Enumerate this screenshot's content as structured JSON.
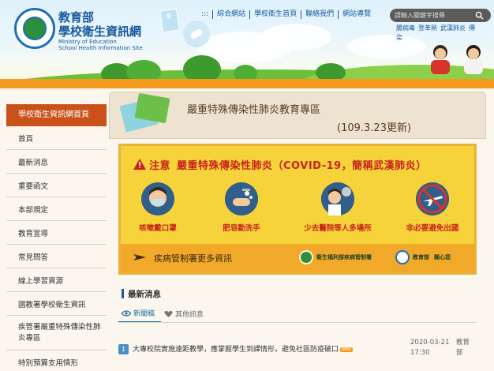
{
  "header": {
    "logo_ring_text": "MINISTRY OF EDUCATION",
    "title_line1": "教育部",
    "title_line2": "學校衛生資訊網",
    "title_en1": "Ministry of Education",
    "title_en2": "School Health Information Site",
    "deco_card_text": "E",
    "nav": [
      "綜合網站",
      "學校衛生首頁",
      "聯絡我們",
      "網站導覽"
    ],
    "nav_prefix": ":::",
    "search_placeholder": "請輸入關鍵字搜尋",
    "hot_keywords": [
      "腸病毒",
      "登革熱",
      "武漢肺炎",
      "傳染"
    ]
  },
  "sidebar": {
    "header": "學校衛生資訊網首頁",
    "items": [
      "首頁",
      "最新消息",
      "重要函文",
      "本部規定",
      "教育宣導",
      "常見問答",
      "線上學習資源",
      "國教署學校衛生資訊",
      "疾管署嚴重特殊傳染性肺炎專區",
      "特別預算支用情形"
    ]
  },
  "main": {
    "page_title": "嚴重特殊傳染性肺炎教育專區",
    "page_date": "(109.3.23更新)",
    "covid": {
      "notice_label": "注意",
      "heading": "嚴重特殊傳染性肺炎（COVID-19，簡稱武漢肺炎）",
      "tips": [
        "咳嗽戴口罩",
        "肥皂勤洗手",
        "少去醫院等人多場所",
        "非必要避免出國"
      ],
      "more_info": "疾病管制署更多資訊",
      "mohw_label": "衛生福利部疾病管制署",
      "moe_label": "教育部",
      "moe_concern": "關心您"
    },
    "news": {
      "title": "最新消息",
      "tabs": [
        "新聞稿",
        "其他訊息"
      ],
      "rows": [
        {
          "num": "1",
          "text": "大專校院實施遠距教學，應掌握學生到課情形，避免社區防疫破口",
          "badge": "NEW",
          "date": "2020-03-21",
          "time": "17:30",
          "unit_line1": "教育",
          "unit_line2": "部"
        }
      ]
    }
  },
  "colors": {
    "brand_blue": "#1a5aa0",
    "sidebar_header": "#c9521b",
    "covid_yellow": "#f7d33b",
    "covid_orange": "#f2a92a",
    "alert_red": "#c7231a"
  }
}
